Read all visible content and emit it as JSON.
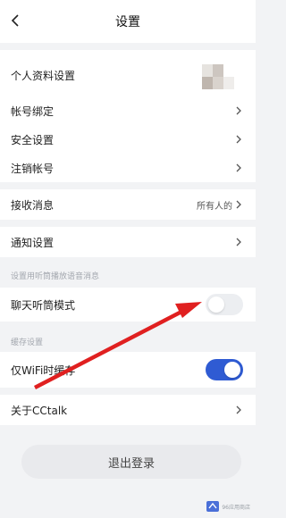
{
  "header": {
    "title": "设置",
    "back_icon": "chevron-left-icon"
  },
  "profile": {
    "label": "个人资料设置"
  },
  "account": {
    "items": [
      {
        "label": "帐号绑定"
      },
      {
        "label": "安全设置"
      },
      {
        "label": "注销帐号"
      }
    ]
  },
  "messages": {
    "receive_label": "接收消息",
    "receive_value": "所有人的"
  },
  "notify": {
    "label": "通知设置"
  },
  "voice_section": {
    "label": "设置用听筒播放语音消息"
  },
  "earpiece": {
    "label": "聊天听筒模式",
    "on": false
  },
  "cache_section": {
    "label": "缓存设置"
  },
  "wifi_cache": {
    "label": "仅WiFi时缓存",
    "on": true
  },
  "about": {
    "label": "关于CCtalk"
  },
  "logout": {
    "label": "退出登录"
  },
  "colors": {
    "accent": "#2f5bd3",
    "annotation_arrow": "#e02020",
    "background": "#f2f3f5"
  },
  "watermark": {
    "text": "96应用商店"
  }
}
